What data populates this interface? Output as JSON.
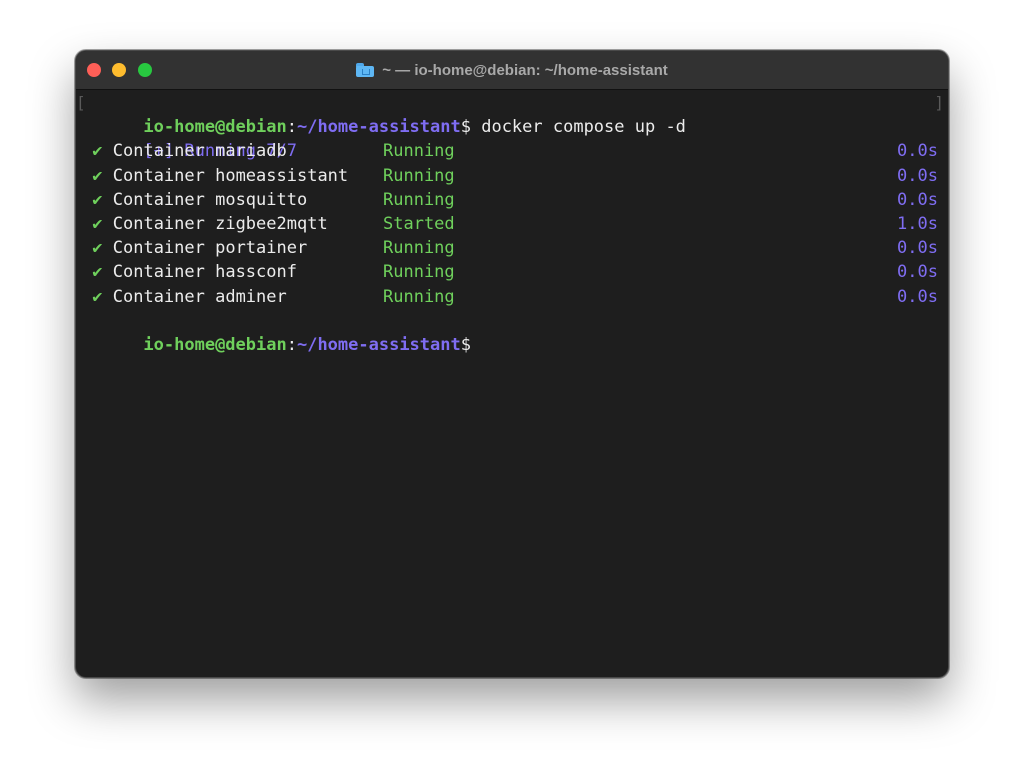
{
  "window": {
    "title": "~ — io-home@debian: ~/home-assistant"
  },
  "prompt": {
    "user_host": "io-home@debian",
    "colon": ":",
    "path": "~/home-assistant",
    "dollar": "$",
    "command": " docker compose up -d"
  },
  "progress": {
    "text": "[+] Running 7/7"
  },
  "containers": [
    {
      "check": "✔",
      "label": "Container mariadb",
      "status": "Running",
      "time": "0.0s"
    },
    {
      "check": "✔",
      "label": "Container homeassistant",
      "status": "Running",
      "time": "0.0s"
    },
    {
      "check": "✔",
      "label": "Container mosquitto",
      "status": "Running",
      "time": "0.0s"
    },
    {
      "check": "✔",
      "label": "Container zigbee2mqtt",
      "status": "Started",
      "time": "1.0s"
    },
    {
      "check": "✔",
      "label": "Container portainer",
      "status": "Running",
      "time": "0.0s"
    },
    {
      "check": "✔",
      "label": "Container hassconf",
      "status": "Running",
      "time": "0.0s"
    },
    {
      "check": "✔",
      "label": "Container adminer",
      "status": "Running",
      "time": "0.0s"
    }
  ],
  "colors": {
    "user_green": "#6fd05c",
    "path_purple": "#7f6df2",
    "background": "#1e1e1e",
    "titlebar": "#323232"
  },
  "icons": {
    "title_icon": "folder-home-icon"
  }
}
